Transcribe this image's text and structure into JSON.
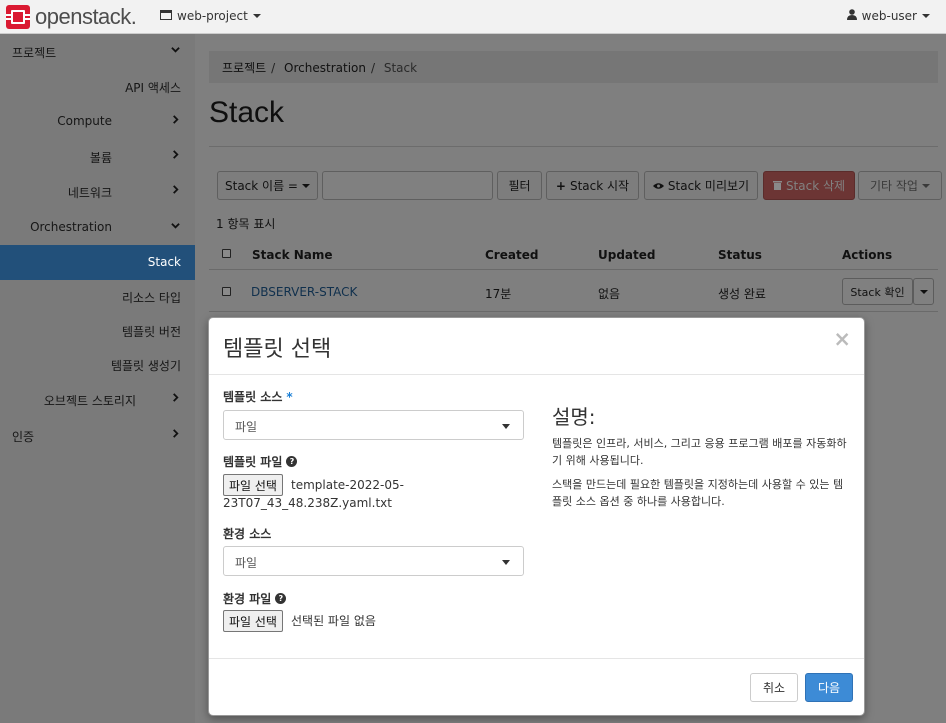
{
  "navbar": {
    "brand": "openstack.",
    "project": "web-project",
    "user": "web-user"
  },
  "sidebar": {
    "items": [
      {
        "label": "프로젝트"
      },
      {
        "label": "API 액세스"
      },
      {
        "label": "Compute"
      },
      {
        "label": "볼륨"
      },
      {
        "label": "네트워크"
      },
      {
        "label": "Orchestration"
      },
      {
        "label": "Stack"
      },
      {
        "label": "리소스 타입"
      },
      {
        "label": "템플릿 버전"
      },
      {
        "label": "템플릿 생성기"
      },
      {
        "label": "오브젝트 스토리지"
      },
      {
        "label": "인증"
      }
    ]
  },
  "breadcrumb": [
    "프로젝트",
    "Orchestration",
    "Stack"
  ],
  "page_title": "Stack",
  "toolbar": {
    "filter_select": "Stack 이름 =",
    "filter_button": "필터",
    "launch": "Stack 시작",
    "preview": "Stack 미리보기",
    "delete": "Stack 삭제",
    "more": "기타 작업"
  },
  "count_text": "1 항목 표시",
  "table": {
    "headers": [
      "Stack Name",
      "Created",
      "Updated",
      "Status",
      "Actions"
    ],
    "rows": [
      {
        "name": "DBSERVER-STACK",
        "created": "17분",
        "updated": "없음",
        "status": "생성 완료",
        "action": "Stack 확인"
      }
    ]
  },
  "modal": {
    "title": "템플릿 선택",
    "close": "×",
    "template_source_label": "템플릿 소스",
    "template_source_value": "파일",
    "template_file_label": "템플릿 파일",
    "template_file_button": "파일 선택",
    "template_file_name_1": "template-2022-05-",
    "template_file_name_2": "23T07_43_48.238Z.yaml.txt",
    "env_source_label": "환경 소스",
    "env_source_value": "파일",
    "env_file_label": "환경 파일",
    "env_file_button": "파일 선택",
    "env_file_name": "선택된 파일 없음",
    "desc_title": "설명:",
    "desc_p1": "템플릿은 인프라, 서비스, 그리고 응용 프로그램 배포를 자동화하기 위해 사용됩니다.",
    "desc_p2": "스택을 만드는데 필요한 템플릿을 지정하는데 사용할 수 있는 템플릿 소스 옵션 중 하나를 사용합니다.",
    "cancel": "취소",
    "next": "다음"
  },
  "colors": {
    "primary": "#3d8bd6",
    "sidebar_active": "#22507a",
    "danger": "#c9302c",
    "logo_red": "#da1a32"
  }
}
